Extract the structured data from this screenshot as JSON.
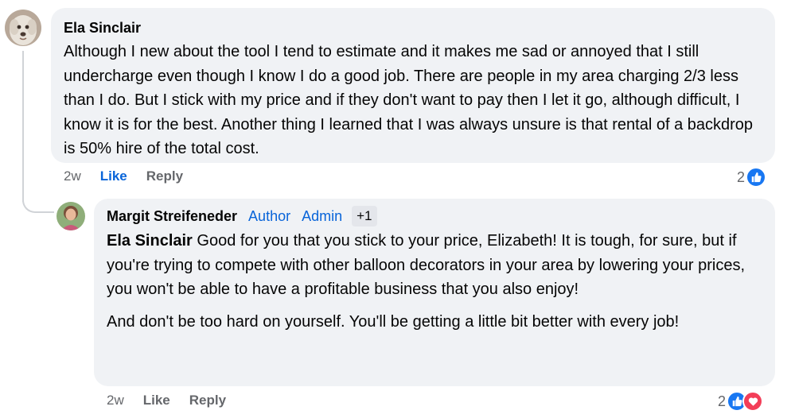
{
  "comments": [
    {
      "author": "Ela Sinclair",
      "text": "Although I new about the tool I tend to estimate and it makes me sad or annoyed that I still undercharge even though I know I do a good job. There are people in my area charging 2/3 less than I do. But I stick with my price and if they don't want to pay then I let it go, although difficult, I know it is for the best. Another thing I learned that I was always unsure is that rental of a backdrop is 50% hire of the total cost.",
      "time": "2w",
      "like_label": "Like",
      "reply_label": "Reply",
      "reaction_count": "2",
      "reactions": [
        "like-icon"
      ]
    },
    {
      "author": "Margit Streifeneder",
      "badges": {
        "author": "Author",
        "admin": "Admin",
        "more": "+1"
      },
      "mention": "Ela Sinclair",
      "text_p1": " Good for you that you stick to your price, Elizabeth! It is tough, for sure, but if you're trying to compete with other balloon decorators in your area by lowering your prices, you won't be able to have a profitable business that you also enjoy!",
      "text_p2": "And don't be too hard on yourself. You'll be getting a little bit better with every job!",
      "time": "2w",
      "like_label": "Like",
      "reply_label": "Reply",
      "reaction_count": "2",
      "reactions": [
        "like-icon",
        "heart-icon"
      ]
    }
  ],
  "colors": {
    "bubble": "#f0f2f5",
    "link_blue": "#0864d9",
    "muted": "#65676b",
    "like_reaction": "#1877f2",
    "love_reaction": "#f33e58"
  }
}
